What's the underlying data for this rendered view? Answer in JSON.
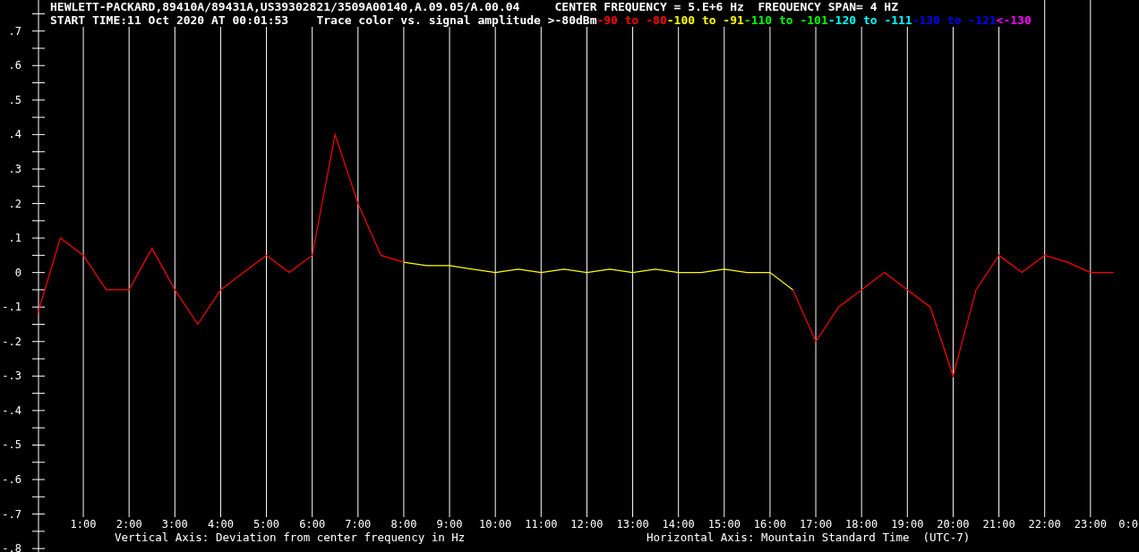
{
  "header": {
    "instrument": "HEWLETT-PACKARD,89410A/89431A,US39302821/3509A00140,A.09.05/A.00.04",
    "center_frequency": "CENTER FREQUENCY = 5.E+6 Hz",
    "frequency_span": "FREQUENCY SPAN= 4 HZ",
    "start_time": "START TIME:11 Oct 2020 AT 00:01:53"
  },
  "legend": {
    "title": "Trace color vs. signal amplitude",
    "items": [
      {
        "label": ">-80dBm",
        "color": "#ffffff"
      },
      {
        "label": "-90 to -80",
        "color": "#ff0000"
      },
      {
        "label": "-100 to -91",
        "color": "#ffff00"
      },
      {
        "label": "-110 to -101",
        "color": "#00ff00"
      },
      {
        "label": "-120 to -111",
        "color": "#00ffff"
      },
      {
        "label": "-130 to -121",
        "color": "#0000ff"
      },
      {
        "label": "<-130",
        "color": "#ff00ff"
      }
    ]
  },
  "chart_data": {
    "type": "line",
    "xlabel": "Horizontal Axis: Mountain Standard Time  (UTC-7)",
    "ylabel": "Vertical Axis: Deviation from center frequency in Hz",
    "grid": true,
    "xlim": [
      -0.82,
      24.06
    ],
    "ylim": [
      -0.81,
      0.79
    ],
    "x": [
      0,
      0.5,
      1,
      1.5,
      2,
      2.5,
      3,
      3.5,
      4,
      4.5,
      5,
      5.5,
      6,
      6.5,
      7,
      7.5,
      8,
      8.5,
      9,
      9.5,
      10,
      10.5,
      11,
      11.5,
      12,
      12.5,
      13,
      13.5,
      14,
      14.5,
      15,
      15.5,
      16,
      16.5,
      17,
      17.5,
      18,
      18.5,
      19,
      19.5,
      20,
      20.5,
      21,
      21.5,
      22,
      22.5,
      23,
      23.5
    ],
    "series": [
      {
        "color": "#ff0000",
        "values": [
          -0.12,
          0.1,
          0.05,
          -0.05,
          -0.05,
          0.07,
          -0.05,
          -0.15,
          -0.05,
          0.0,
          0.05,
          0.0,
          0.05,
          0.4,
          0.2,
          0.05,
          0.03,
          null,
          null,
          null,
          null,
          null,
          null,
          null,
          null,
          null,
          null,
          null,
          null,
          null,
          null,
          null,
          null,
          -0.05,
          -0.2,
          -0.1,
          -0.05,
          0.0,
          -0.05,
          -0.1,
          -0.3,
          -0.05,
          0.05,
          0.0,
          0.05,
          0.03,
          0.0,
          0.0
        ]
      },
      {
        "color": "#ffff00",
        "values": [
          null,
          null,
          null,
          null,
          null,
          null,
          null,
          null,
          null,
          null,
          null,
          null,
          null,
          null,
          null,
          null,
          0.03,
          0.02,
          0.02,
          0.01,
          0.0,
          0.01,
          0.0,
          0.01,
          0.0,
          0.01,
          0.0,
          0.01,
          0.0,
          0.0,
          0.01,
          0.0,
          0.0,
          -0.05,
          null,
          null,
          null,
          null,
          null,
          null,
          null,
          null,
          null,
          null,
          null,
          null,
          null,
          null
        ]
      }
    ],
    "xticks": [
      {
        "value": 1,
        "label": "1:00"
      },
      {
        "value": 2,
        "label": "2:00"
      },
      {
        "value": 3,
        "label": "3:00"
      },
      {
        "value": 4,
        "label": "4:00"
      },
      {
        "value": 5,
        "label": "5:00"
      },
      {
        "value": 6,
        "label": "6:00"
      },
      {
        "value": 7,
        "label": "7:00"
      },
      {
        "value": 8,
        "label": "8:00"
      },
      {
        "value": 9,
        "label": "9:00"
      },
      {
        "value": 10,
        "label": "10:00"
      },
      {
        "value": 11,
        "label": "11:00"
      },
      {
        "value": 12,
        "label": "12:00"
      },
      {
        "value": 13,
        "label": "13:00"
      },
      {
        "value": 14,
        "label": "14:00"
      },
      {
        "value": 15,
        "label": "15:00"
      },
      {
        "value": 16,
        "label": "16:00"
      },
      {
        "value": 17,
        "label": "17:00"
      },
      {
        "value": 18,
        "label": "18:00"
      },
      {
        "value": 19,
        "label": "19:00"
      },
      {
        "value": 20,
        "label": "20:00"
      },
      {
        "value": 21,
        "label": "21:00"
      },
      {
        "value": 22,
        "label": "22:00"
      },
      {
        "value": 23,
        "label": "23:00"
      },
      {
        "value": 24,
        "label": "0:0"
      }
    ],
    "yticks": [
      {
        "value": 0.7,
        "label": ".7"
      },
      {
        "value": 0.6,
        "label": ".6"
      },
      {
        "value": 0.5,
        "label": ".5"
      },
      {
        "value": 0.4,
        "label": ".4"
      },
      {
        "value": 0.3,
        "label": ".3"
      },
      {
        "value": 0.2,
        "label": ".2"
      },
      {
        "value": 0.1,
        "label": ".1"
      },
      {
        "value": 0,
        "label": "0"
      },
      {
        "value": -0.1,
        "label": "-.1"
      },
      {
        "value": -0.2,
        "label": "-.2"
      },
      {
        "value": -0.3,
        "label": "-.3"
      },
      {
        "value": -0.4,
        "label": "-.4"
      },
      {
        "value": -0.5,
        "label": "-.5"
      },
      {
        "value": -0.6,
        "label": "-.6"
      },
      {
        "value": -0.7,
        "label": "-.7"
      },
      {
        "value": -0.8,
        "label": "-.8"
      }
    ]
  }
}
